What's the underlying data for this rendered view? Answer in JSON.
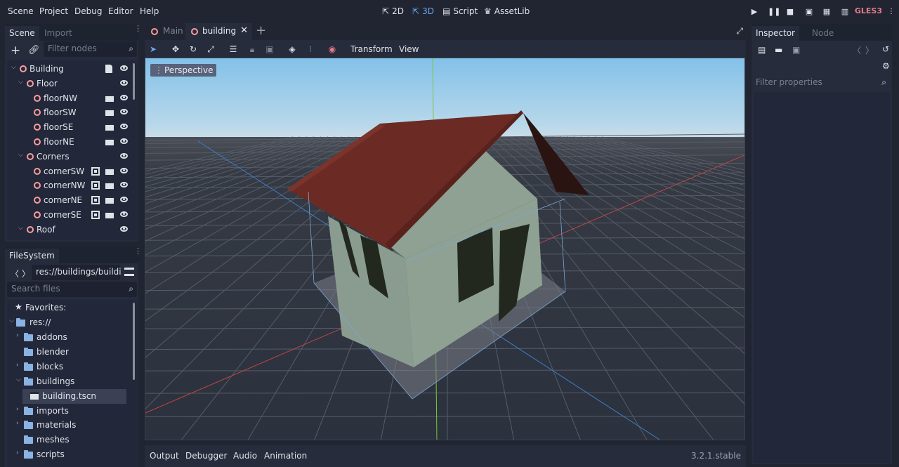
{
  "menu": {
    "items": [
      "Scene",
      "Project",
      "Debug",
      "Editor",
      "Help"
    ],
    "workspaces": [
      {
        "label": "2D",
        "active": false
      },
      {
        "label": "3D",
        "active": true
      },
      {
        "label": "Script",
        "active": false
      },
      {
        "label": "AssetLib",
        "active": false
      }
    ],
    "renderer": "GLES3"
  },
  "scene_dock": {
    "tabs": [
      "Scene",
      "Import"
    ],
    "filter_placeholder": "Filter nodes",
    "tree": [
      {
        "label": "Building",
        "depth": 0,
        "expanded": true
      },
      {
        "label": "Floor",
        "depth": 1,
        "expanded": true
      },
      {
        "label": "floorNW",
        "depth": 2
      },
      {
        "label": "floorSW",
        "depth": 2
      },
      {
        "label": "floorSE",
        "depth": 2
      },
      {
        "label": "floorNE",
        "depth": 2
      },
      {
        "label": "Corners",
        "depth": 1,
        "expanded": true
      },
      {
        "label": "cornerSW",
        "depth": 2
      },
      {
        "label": "cornerNW",
        "depth": 2
      },
      {
        "label": "cornerNE",
        "depth": 2
      },
      {
        "label": "cornerSE",
        "depth": 2
      },
      {
        "label": "Roof",
        "depth": 1,
        "expanded": true
      }
    ]
  },
  "filesystem": {
    "tab": "FileSystem",
    "path": "res://buildings/buildi",
    "search_placeholder": "Search files",
    "favorites": "Favorites:",
    "root": "res://",
    "items": [
      "addons",
      "blender",
      "blocks",
      "buildings",
      "building.tscn",
      "imports",
      "materials",
      "meshes",
      "scripts"
    ]
  },
  "editor_tabs": [
    "Main",
    "building"
  ],
  "viewport_toolbar": {
    "transform": "Transform",
    "view": "View"
  },
  "viewport": {
    "perspective_label": "Perspective"
  },
  "inspector": {
    "tabs": [
      "Inspector",
      "Node"
    ],
    "filter_placeholder": "Filter properties"
  },
  "bottom_panel": {
    "tabs": [
      "Output",
      "Debugger",
      "Audio",
      "Animation"
    ],
    "version": "3.2.1.stable"
  },
  "colors": {
    "accent": "#6aa8f5",
    "node_icon": "#fc9c9c",
    "roof": "#6b2b24",
    "wall": "#889c8e",
    "sky_top": "#83c1e9",
    "ground": "#2b313d"
  }
}
